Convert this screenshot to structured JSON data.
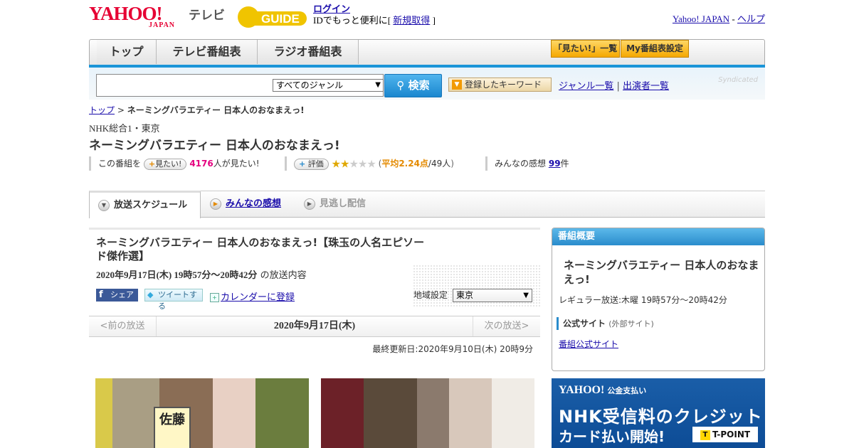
{
  "header": {
    "logo_text": "YAHOO!",
    "logo_sub": "JAPAN",
    "tv_word": "テレビ",
    "gguide_text": "GUIDE",
    "login_link": "ログイン",
    "login_pre": "IDでもっと便利に[ ",
    "signup_link": "新規取得",
    "login_post": " ]",
    "yj_link": "Yahoo! JAPAN",
    "sep": " - ",
    "help_link": "ヘルプ"
  },
  "nav": {
    "tabs": [
      "トップ",
      "テレビ番組表",
      "ラジオ番組表"
    ],
    "want_list": "「見たい!」一覧",
    "my_settings": "My番組表設定"
  },
  "search": {
    "placeholder": "",
    "genre": "すべてのジャンル",
    "button": "検索",
    "keyword_btn": "登録したキーワード",
    "genre_list": "ジャンル一覧",
    "divider": "|",
    "cast_list": "出演者一覧",
    "syndicated": "Syndicated"
  },
  "breadcrumb": {
    "top": "トップ",
    "sep": " > ",
    "current": "ネーミングバラエティー 日本人のおなまえっ!"
  },
  "program": {
    "channel": "NHK総合1・東京",
    "title": "ネーミングバラエティー 日本人のおなまえっ!",
    "want_prefix": "この番組を",
    "want_btn": "見たい!",
    "want_count": "4176",
    "want_suffix": "人が見たい!",
    "rate_btn": "評価",
    "stars_on": "★★",
    "stars_off": "★★★",
    "avg_open": "(",
    "avg_label": "平均2.24点",
    "avg_count": "/49人",
    "avg_close": ")",
    "reviews_label": "みんなの感想",
    "reviews_count": "99",
    "reviews_suffix": "件"
  },
  "subtabs": {
    "schedule": "放送スケジュール",
    "reviews": "みんなの感想",
    "missed": "見逃し配信"
  },
  "episode": {
    "title": "ネーミングバラエティー 日本人のおなまえっ!【珠玉の人名エピソード傑作選】",
    "date_bold": "2020年9月17日(木) 19時57分～20時42分",
    "date_suffix": "の放送内容",
    "share_fb": "シェア",
    "share_tw": "ツイートする",
    "calendar": "カレンダーに登録",
    "region_label": "地域設定",
    "region_value": "東京",
    "prev": "<前の放送",
    "current_date": "2020年9月17日(木)",
    "next": "次の放送>",
    "updated": "最終更新日:2020年9月10日(木) 20時9分",
    "sign_text": "佐藤"
  },
  "sidebar": {
    "header": "番組概要",
    "title": "ネーミングバラエティー 日本人のおなまえっ!",
    "regular": "レギュラー放送:木曜 19時57分～20時42分",
    "official": "公式サイト",
    "official_note": "(外部サイト)",
    "official_link": "番組公式サイト"
  },
  "ad": {
    "logo": "YAHOO!",
    "logo_note": "公金支払い",
    "line1": "NHK受信料のクレジット",
    "line2": "カード払い開始!",
    "tpoint": "T-POINT"
  },
  "colors": {
    "nav_blue": "#1b95d8",
    "accent_pink": "#e4007f",
    "accent_orange": "#e48a00",
    "yahoo_red": "#e60033"
  }
}
